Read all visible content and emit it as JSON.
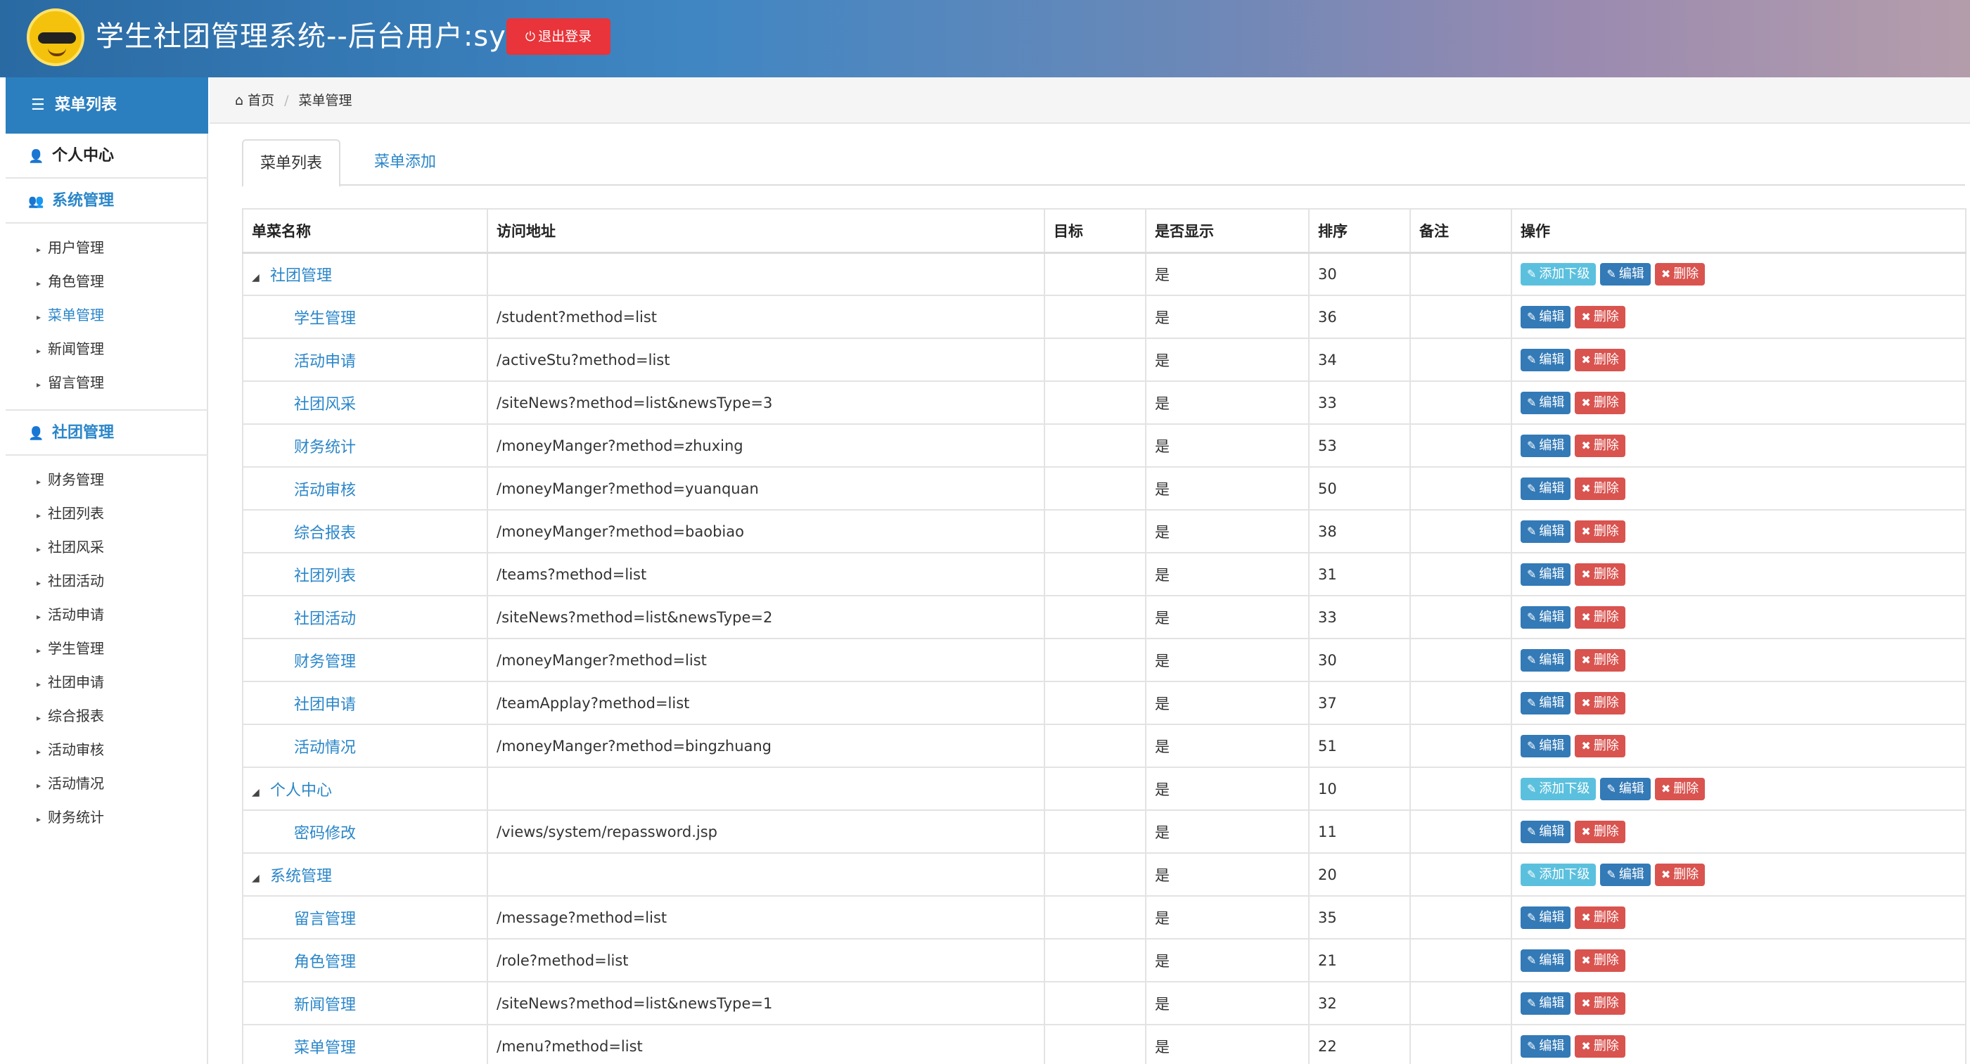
{
  "header": {
    "title": "学生社团管理系统--后台用户:sys",
    "logout_label": "退出登录"
  },
  "sidebar": {
    "heading": "菜单列表",
    "personal_center": "个人中心",
    "system_section": "系统管理",
    "system_items": [
      "用户管理",
      "角色管理",
      "菜单管理",
      "新闻管理",
      "留言管理"
    ],
    "club_section": "社团管理",
    "club_items": [
      "财务管理",
      "社团列表",
      "社团风采",
      "社团活动",
      "活动申请",
      "学生管理",
      "社团申请",
      "综合报表",
      "活动审核",
      "活动情况",
      "财务统计"
    ]
  },
  "breadcrumb": {
    "home": "首页",
    "current": "菜单管理"
  },
  "tabs": {
    "list": "菜单列表",
    "add": "菜单添加"
  },
  "table": {
    "headers": [
      "单菜名称",
      "访问地址",
      "目标",
      "是否显示",
      "排序",
      "备注",
      "操作"
    ],
    "actions": {
      "add_child": "添加下级",
      "edit": "编辑",
      "delete": "删除"
    },
    "rows": [
      {
        "name": "社团管理",
        "url": "",
        "target": "",
        "show": "是",
        "order": "30",
        "note": ""
      },
      {
        "name": "学生管理",
        "url": "/student?method=list",
        "target": "",
        "show": "是",
        "order": "36",
        "note": ""
      },
      {
        "name": "活动申请",
        "url": "/activeStu?method=list",
        "target": "",
        "show": "是",
        "order": "34",
        "note": ""
      },
      {
        "name": "社团风采",
        "url": "/siteNews?method=list&newsType=3",
        "target": "",
        "show": "是",
        "order": "33",
        "note": ""
      },
      {
        "name": "财务统计",
        "url": "/moneyManger?method=zhuxing",
        "target": "",
        "show": "是",
        "order": "53",
        "note": ""
      },
      {
        "name": "活动审核",
        "url": "/moneyManger?method=yuanquan",
        "target": "",
        "show": "是",
        "order": "50",
        "note": ""
      },
      {
        "name": "综合报表",
        "url": "/moneyManger?method=baobiao",
        "target": "",
        "show": "是",
        "order": "38",
        "note": ""
      },
      {
        "name": "社团列表",
        "url": "/teams?method=list",
        "target": "",
        "show": "是",
        "order": "31",
        "note": ""
      },
      {
        "name": "社团活动",
        "url": "/siteNews?method=list&newsType=2",
        "target": "",
        "show": "是",
        "order": "33",
        "note": ""
      },
      {
        "name": "财务管理",
        "url": "/moneyManger?method=list",
        "target": "",
        "show": "是",
        "order": "30",
        "note": ""
      },
      {
        "name": "社团申请",
        "url": "/teamApplay?method=list",
        "target": "",
        "show": "是",
        "order": "37",
        "note": ""
      },
      {
        "name": "活动情况",
        "url": "/moneyManger?method=bingzhuang",
        "target": "",
        "show": "是",
        "order": "51",
        "note": ""
      },
      {
        "name": "个人中心",
        "url": "",
        "target": "",
        "show": "是",
        "order": "10",
        "note": ""
      },
      {
        "name": "密码修改",
        "url": "/views/system/repassword.jsp",
        "target": "",
        "show": "是",
        "order": "11",
        "note": ""
      },
      {
        "name": "系统管理",
        "url": "",
        "target": "",
        "show": "是",
        "order": "20",
        "note": ""
      },
      {
        "name": "留言管理",
        "url": "/message?method=list",
        "target": "",
        "show": "是",
        "order": "35",
        "note": ""
      },
      {
        "name": "角色管理",
        "url": "/role?method=list",
        "target": "",
        "show": "是",
        "order": "21",
        "note": ""
      },
      {
        "name": "新闻管理",
        "url": "/siteNews?method=list&newsType=1",
        "target": "",
        "show": "是",
        "order": "32",
        "note": ""
      },
      {
        "name": "菜单管理",
        "url": "/menu?method=list",
        "target": "",
        "show": "是",
        "order": "22",
        "note": ""
      }
    ]
  },
  "colors": {
    "primary": "#337ab7",
    "info": "#5bc0de",
    "danger": "#d9534f",
    "link": "#2a86c9",
    "logout": "#e8343a"
  }
}
